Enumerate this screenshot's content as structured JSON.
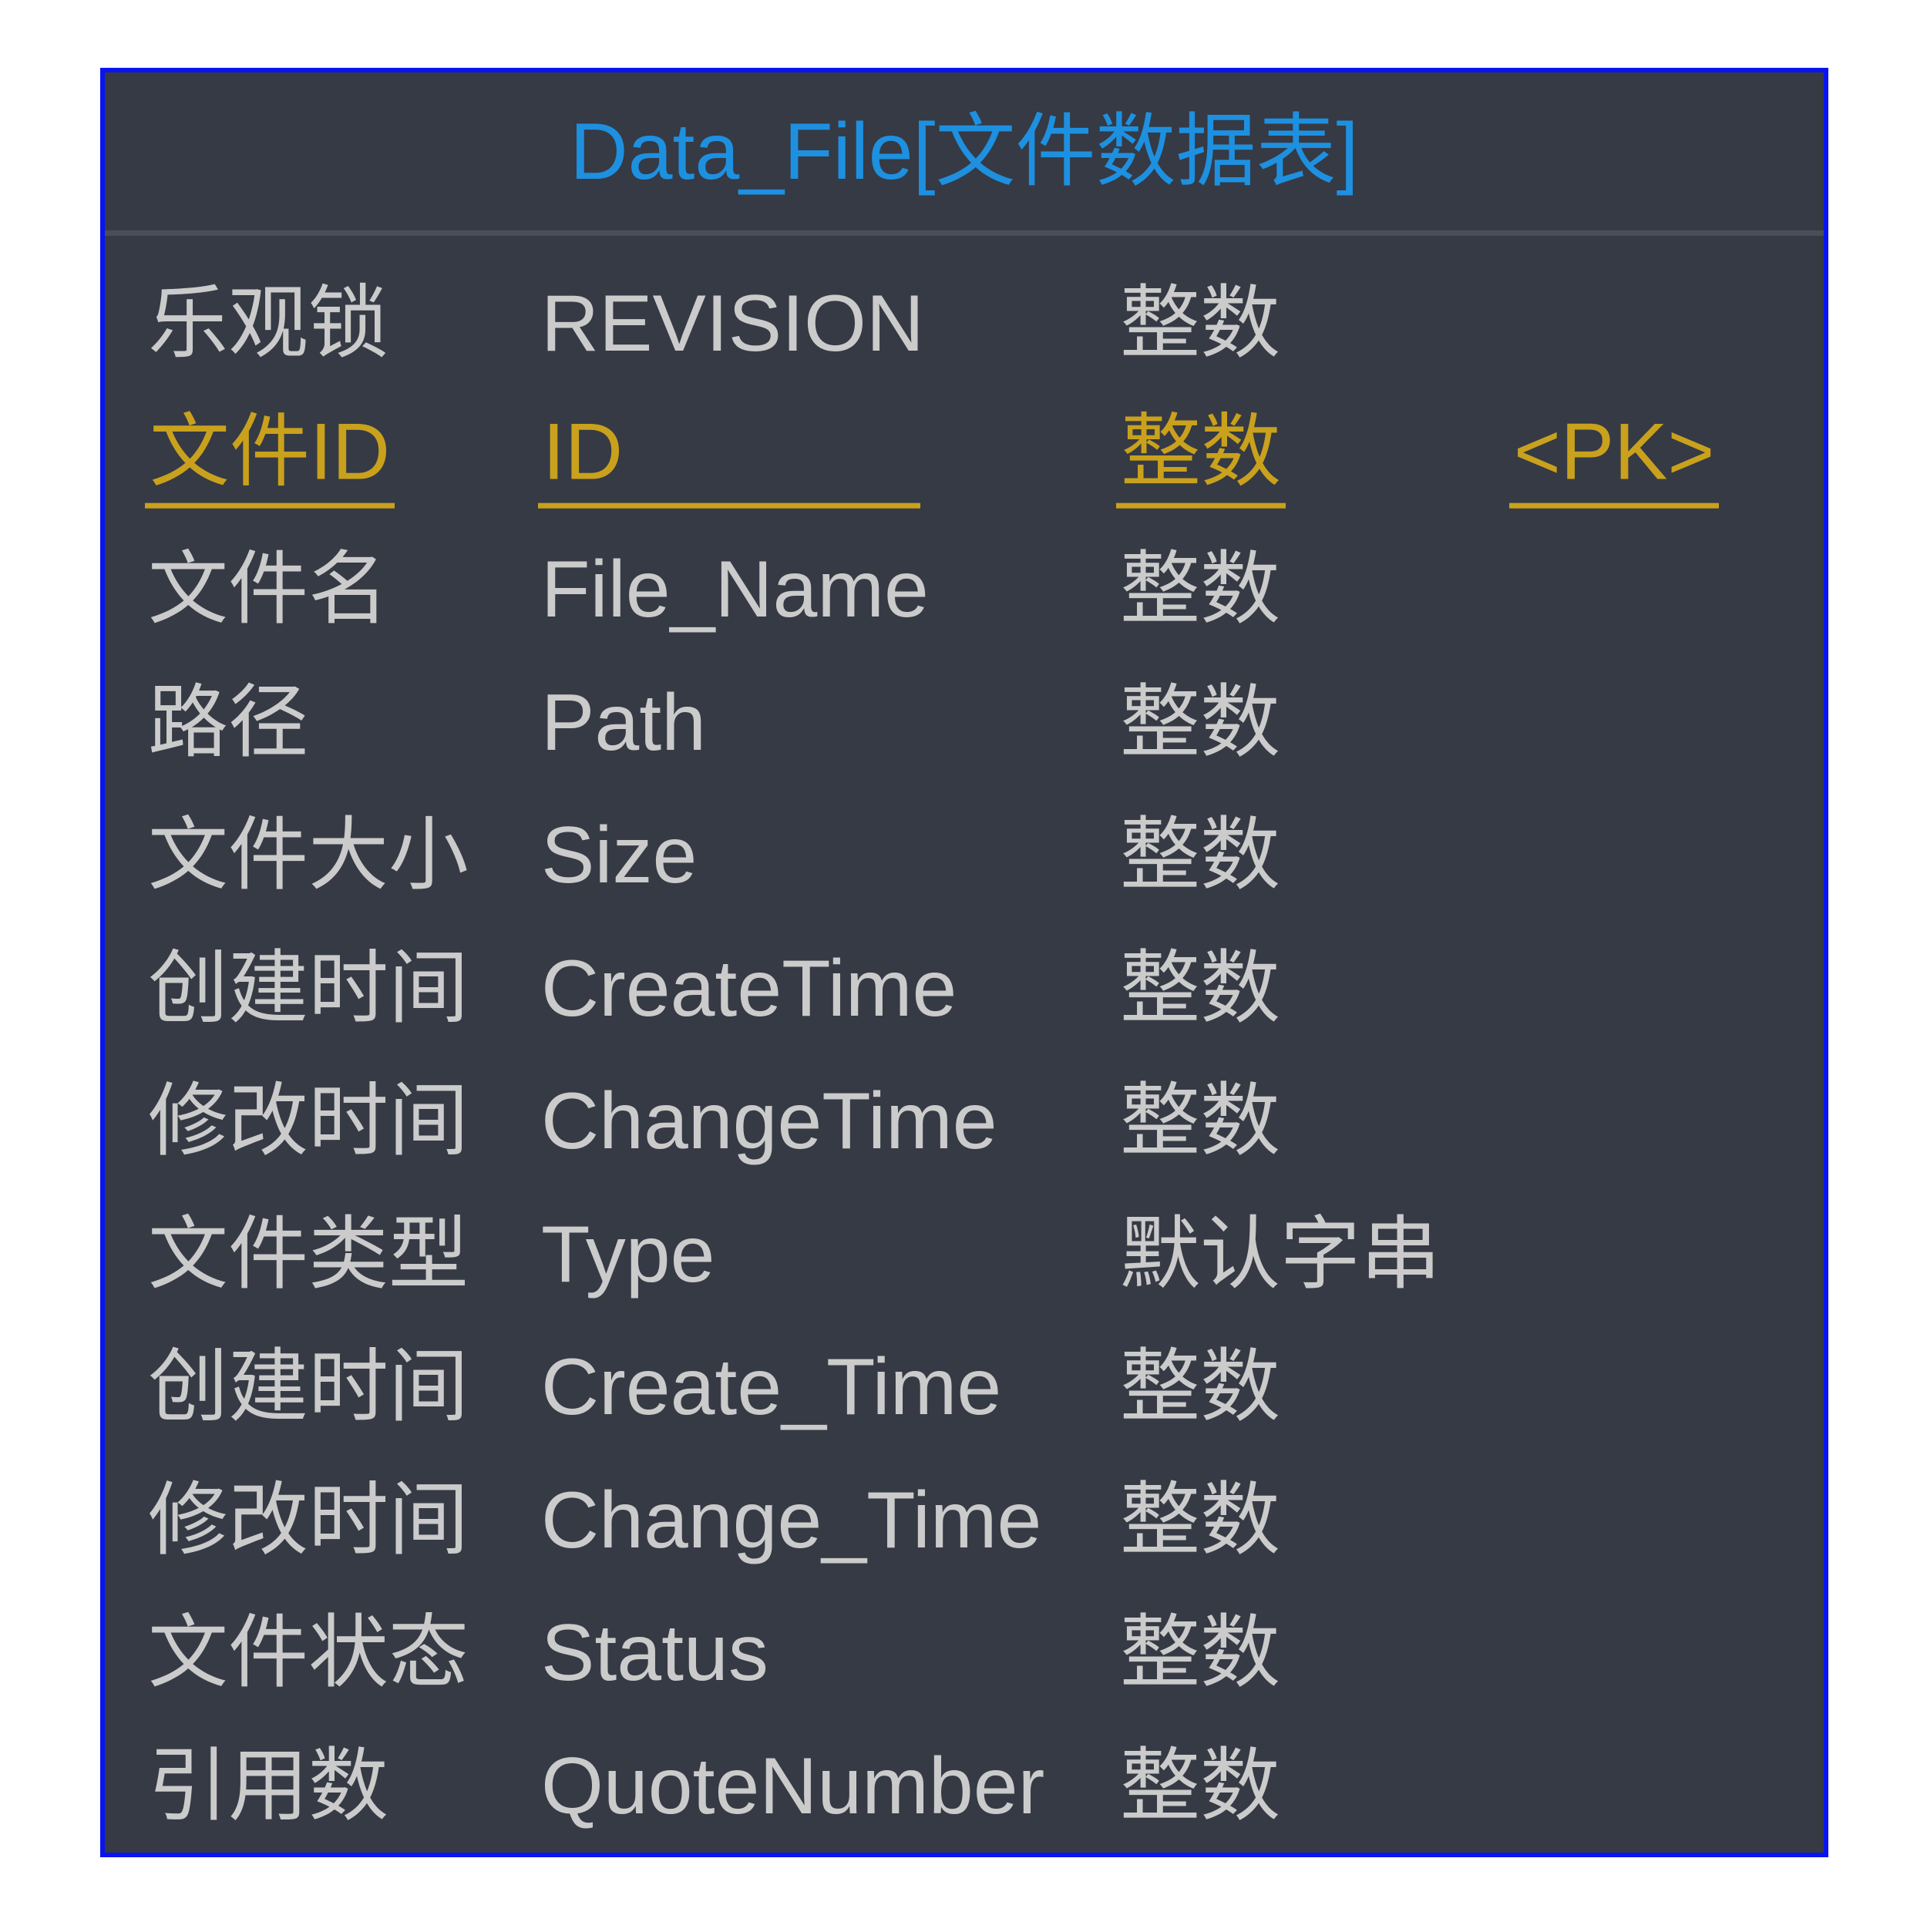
{
  "entity": {
    "title": "Data_File[文件数据表]",
    "colors": {
      "background": "#353a45",
      "border": "#0a14f0",
      "title": "#1e90e0",
      "text": "#cbcbcb",
      "primary_key": "#c9a11c",
      "divider": "#4a4e58"
    },
    "rows": [
      {
        "label": "乐观锁",
        "name": "REVISION",
        "type": "整数",
        "key": "",
        "pk": false
      },
      {
        "label": "文件ID",
        "name": "ID",
        "type": "整数",
        "key": "<PK>",
        "pk": true
      },
      {
        "label": "文件名",
        "name": "File_Name",
        "type": "整数",
        "key": "",
        "pk": false
      },
      {
        "label": "路径",
        "name": "Path",
        "type": "整数",
        "key": "",
        "pk": false
      },
      {
        "label": "文件大小",
        "name": "Size",
        "type": "整数",
        "key": "",
        "pk": false
      },
      {
        "label": "创建时间",
        "name": "CreateTime",
        "type": "整数",
        "key": "",
        "pk": false
      },
      {
        "label": "修改时间",
        "name": "ChangeTime",
        "type": "整数",
        "key": "",
        "pk": false
      },
      {
        "label": "文件类型",
        "name": "Type",
        "type": "默认字串",
        "key": "",
        "pk": false
      },
      {
        "label": "创建时间",
        "name": "Create_Time",
        "type": "整数",
        "key": "",
        "pk": false
      },
      {
        "label": "修改时间",
        "name": "Change_Time",
        "type": "整数",
        "key": "",
        "pk": false
      },
      {
        "label": "文件状态",
        "name": "Status",
        "type": "整数",
        "key": "",
        "pk": false
      },
      {
        "label": "引用数",
        "name": "QuoteNumber",
        "type": "整数",
        "key": "",
        "pk": false
      }
    ]
  }
}
